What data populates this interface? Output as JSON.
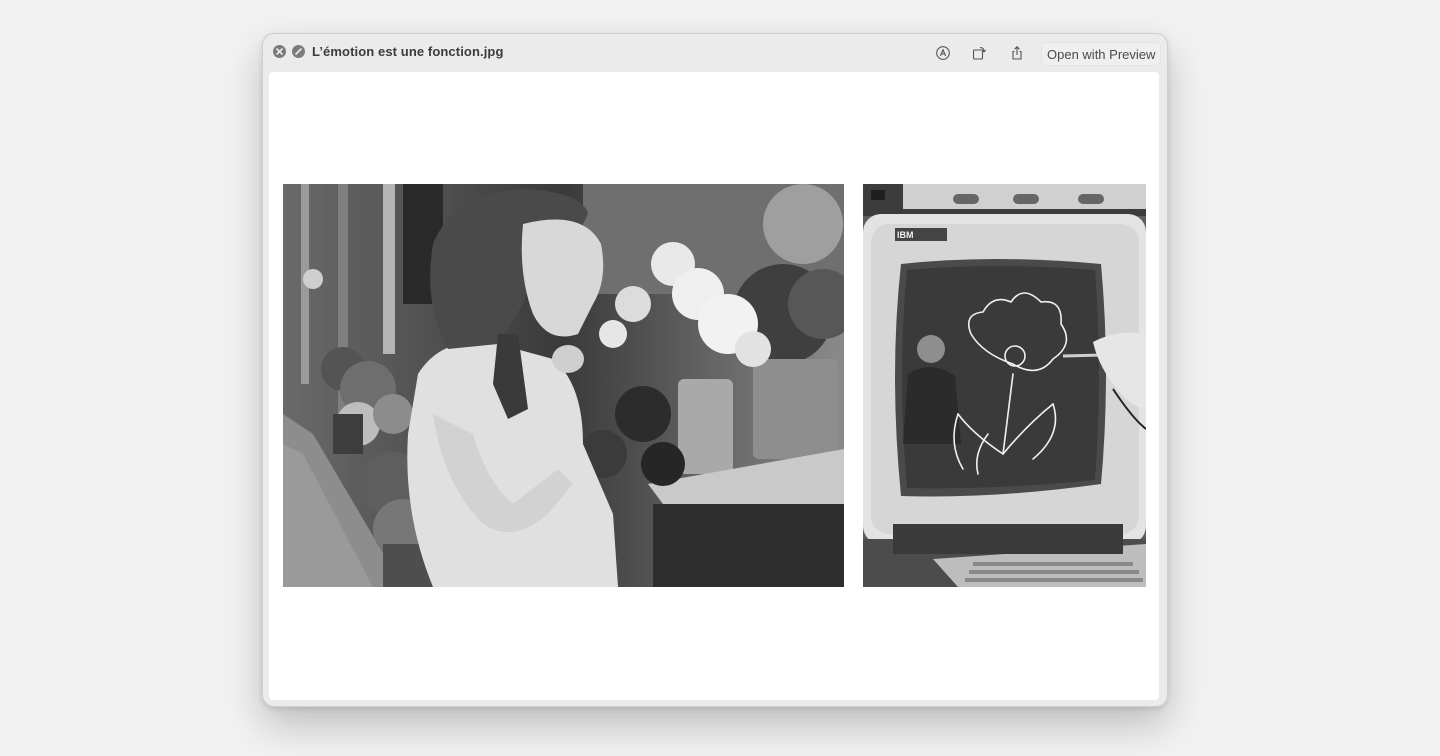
{
  "window": {
    "title": "L’émotion est une fonction.jpg",
    "open_button_label": "Open with Preview"
  },
  "icons": {
    "close": "close-icon",
    "disabled": "disabled-icon",
    "markup": "markup-icon",
    "rotate": "rotate-icon",
    "share": "share-icon"
  },
  "monitor": {
    "brand_label": "IBM"
  },
  "colors": {
    "desktop": "#f2f2f2",
    "titlebar": "#ecebeb",
    "content": "#ffffff",
    "traffic": "#7b7b7b"
  }
}
